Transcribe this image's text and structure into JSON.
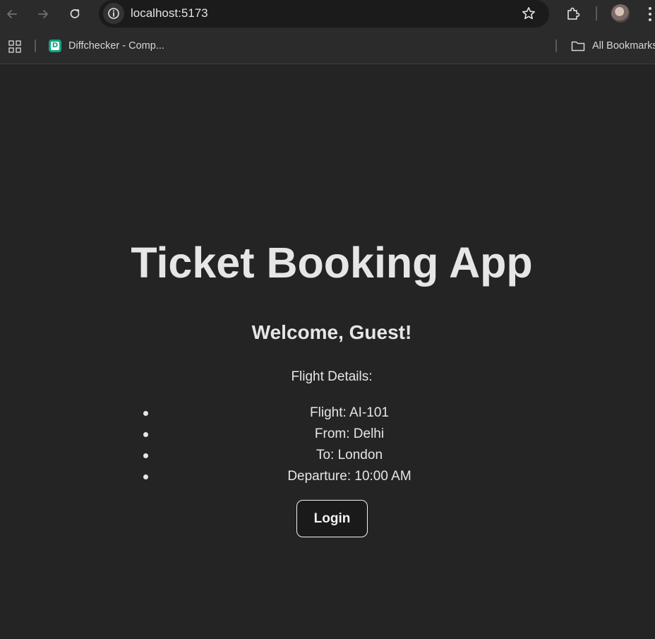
{
  "browser": {
    "url": "localhost:5173",
    "bookmarks": [
      {
        "label": "Diffchecker - Comp...",
        "icon": "diffchecker-favicon"
      }
    ],
    "all_bookmarks_label": "All Bookmarks"
  },
  "app": {
    "title": "Ticket Booking App",
    "welcome": "Welcome, Guest!",
    "details_label": "Flight Details:",
    "flight_details": [
      "Flight: AI-101",
      "From: Delhi",
      "To: London",
      "Departure: 10:00 AM"
    ],
    "login_label": "Login"
  },
  "colors": {
    "page_background": "#242424",
    "browser_chrome": "#2b2b2b",
    "text": "#e6e6e6"
  }
}
